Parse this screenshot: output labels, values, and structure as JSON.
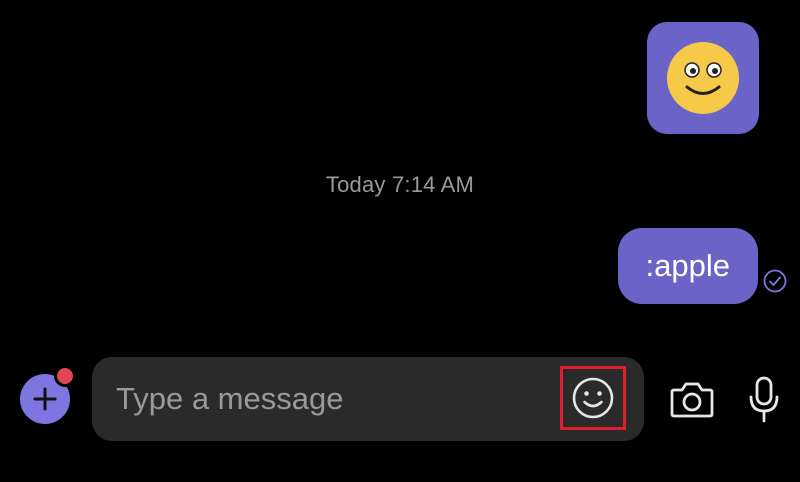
{
  "conversation": {
    "sticker": {
      "icon": "smiley-sticker-icon",
      "background": "#6a64c8",
      "face_color": "#f7c948"
    },
    "timestamp": "Today 7:14 AM",
    "sent_message": {
      "text": ":apple",
      "status_icon": "read-check-icon"
    }
  },
  "composer": {
    "placeholder": "Type a message",
    "value": "",
    "attach_icon": "plus-icon",
    "emoji_icon": "smiley-icon",
    "camera_icon": "camera-icon",
    "mic_icon": "microphone-icon"
  },
  "colors": {
    "background": "#000000",
    "accent": "#6a64c8",
    "notification": "#e04654",
    "highlight": "#e01e2e",
    "input_background": "#2a2a2a"
  }
}
